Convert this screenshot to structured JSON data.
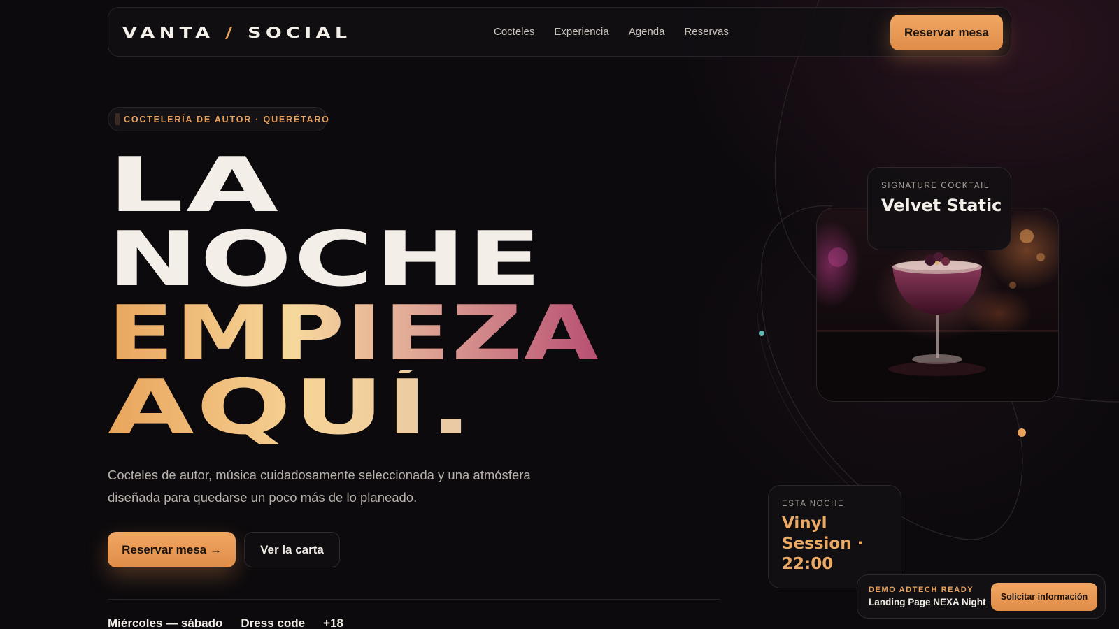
{
  "brand": {
    "logo_left": "VANTA",
    "logo_slash": "/",
    "logo_right": "SOCIAL",
    "accent": "#e9a25c"
  },
  "nav": {
    "links": [
      "Cocteles",
      "Experiencia",
      "Agenda",
      "Reservas"
    ],
    "cta": "Reservar mesa"
  },
  "hero": {
    "badge": "COCTELERÍA DE AUTOR · QUERÉTARO",
    "headline": [
      "LA",
      "NOCHE",
      "EMPIEZA",
      "AQUÍ."
    ],
    "description": "Cocteles de autor, música cuidadosamente seleccionada y una atmósfera diseñada para quedarse un poco más de lo planeado.",
    "primary_cta": "Reservar mesa →",
    "secondary_cta": "Ver la carta",
    "meta": [
      "Miércoles — sábado",
      "Dress code",
      "+18"
    ]
  },
  "signature": {
    "label": "SIGNATURE COCKTAIL",
    "title": "Velvet Static"
  },
  "tonight": {
    "label": "ESTA NOCHE",
    "title": "Vinyl Session · 22:00"
  },
  "demo_bar": {
    "kicker": "DEMO ADTECH READY",
    "title": "Landing Page NEXA Night",
    "cta": "Solicitar información"
  }
}
